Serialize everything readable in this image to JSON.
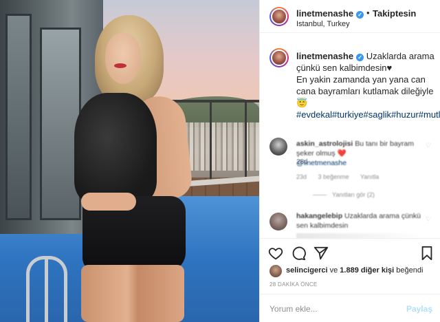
{
  "header": {
    "username": "linetmenashe",
    "separator": "•",
    "follow_status": "Takiptesin",
    "location": "Istanbul, Turkey"
  },
  "caption": {
    "username": "linetmenashe",
    "line1": "Uzaklarda arama çünkü sen kalbimdesin♥",
    "line2": "En yakin zamanda yan yana can cana bayramları kutlamak dileğiyle😇",
    "hashtags": "#evdekal#turkiye#saglik#huzur#mutluluk",
    "time_ago": "28d"
  },
  "comments": [
    {
      "username": "askin_astrolojisi",
      "text": "Bu tanı bir bayram şeker olmuş",
      "emoji": "❤️",
      "mention": "@linetmenashe",
      "time": "23d",
      "likes": "3 beğenme",
      "reply": "Yanıtla",
      "view_replies": "Yanıtları gör (2)"
    },
    {
      "username": "hakangelebip",
      "text": "Uzaklarda arama çünkü sen kalbimdesin"
    }
  ],
  "actions": {
    "like_icon": "heart-icon",
    "comment_icon": "comment-icon",
    "share_icon": "share-icon",
    "save_icon": "bookmark-icon"
  },
  "likes": {
    "user": "selincigerci",
    "connector": "ve",
    "others": "1.889 diğer kişi",
    "suffix": "beğendi"
  },
  "post_date": "28 DAKİKA ÖNCE",
  "comment_box": {
    "placeholder": "Yorum ekle...",
    "post_label": "Paylaş"
  }
}
